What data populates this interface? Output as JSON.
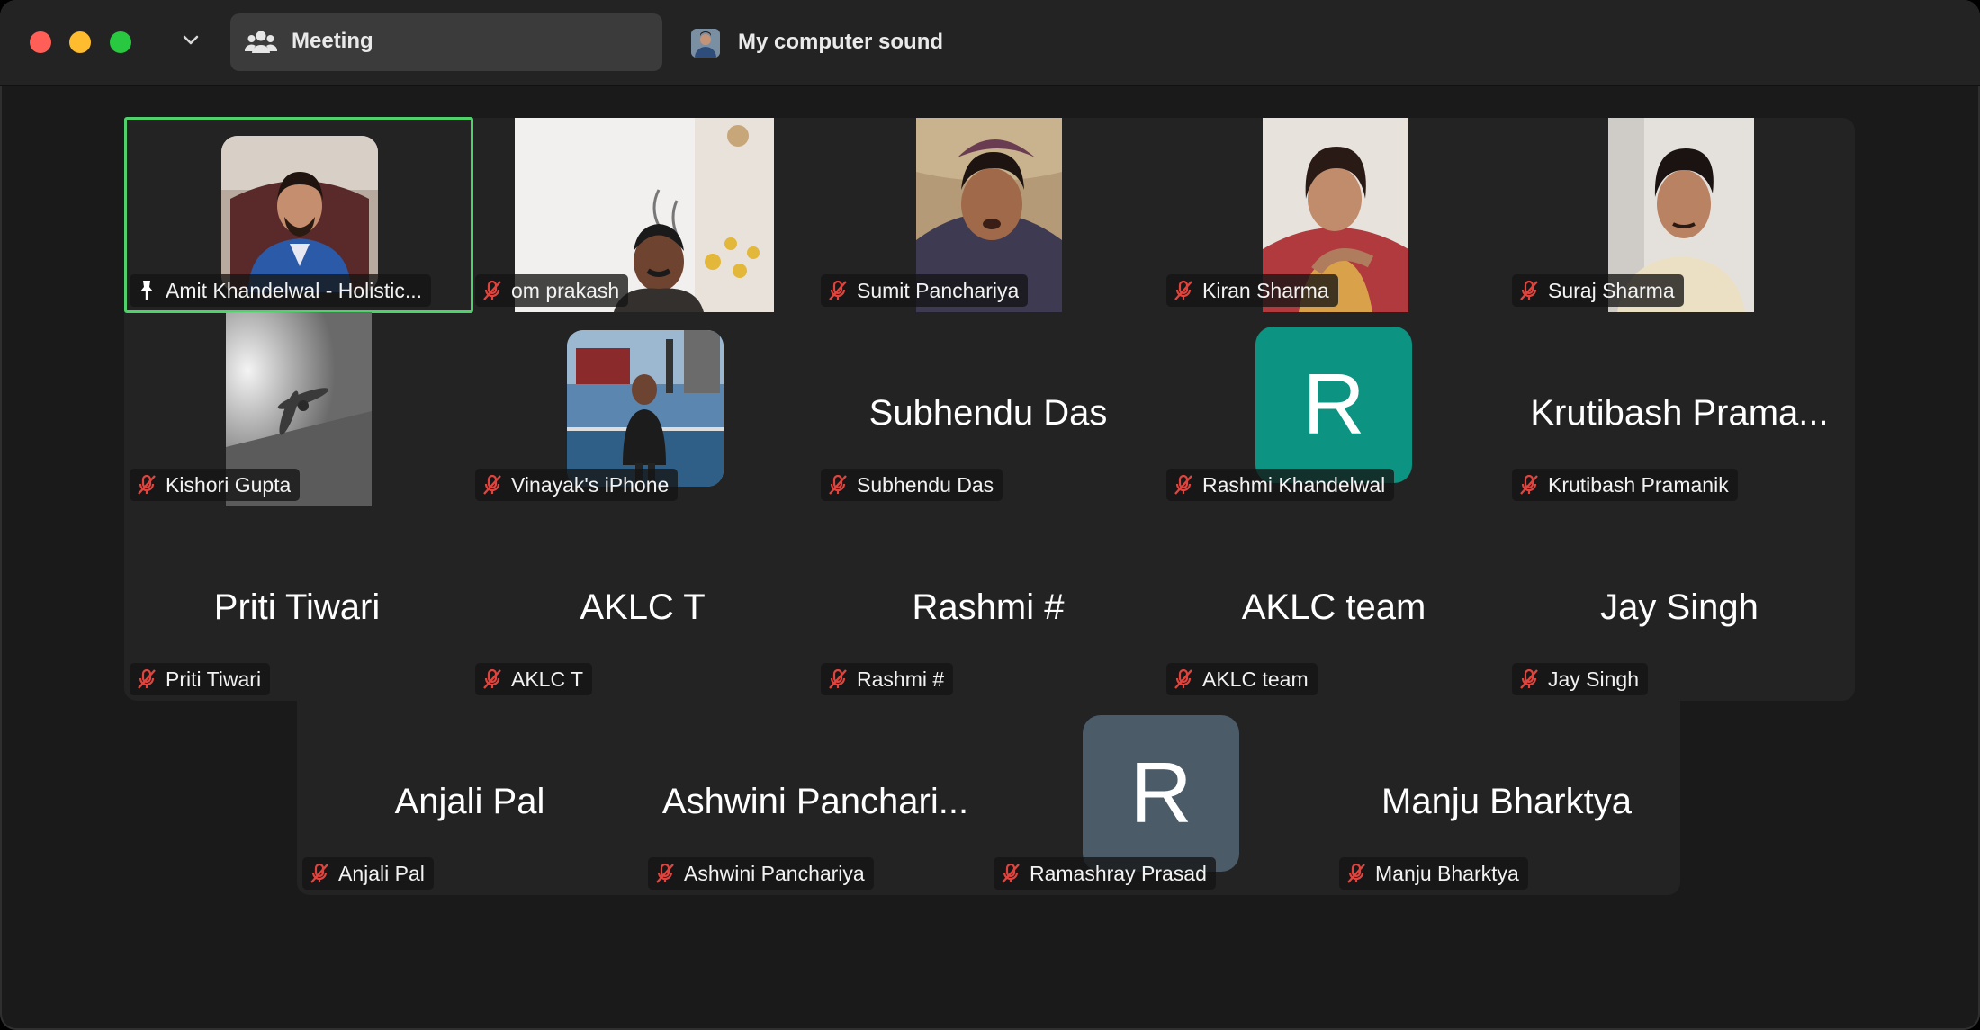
{
  "titlebar": {
    "meeting_tab_label": "Meeting",
    "sound_tab_label": "My computer sound",
    "traffic_lights": {
      "close": "#ff5f57",
      "minimize": "#febc2e",
      "zoom": "#28c840"
    }
  },
  "colors": {
    "window_bg": "#1a1a1a",
    "grid_bg": "#232323",
    "active_speaker_border": "#4fd26a",
    "muted_icon": "#e0443e",
    "avatar_teal": "#0c9382",
    "avatar_slate": "#4b5b68"
  },
  "participants": [
    {
      "display_name": "Amit Khandelwal - Holistic...",
      "tag_icon": "pin-icon",
      "video": true,
      "active_speaker": true
    },
    {
      "display_name": "om prakash",
      "tag_icon": "mic-muted-icon",
      "video": true
    },
    {
      "display_name": "Sumit Panchariya",
      "tag_icon": "mic-muted-icon",
      "video": true
    },
    {
      "display_name": "Kiran Sharma",
      "tag_icon": "mic-muted-icon",
      "video": true
    },
    {
      "display_name": "Suraj Sharma",
      "tag_icon": "mic-muted-icon",
      "video": true
    },
    {
      "display_name": "Kishori Gupta",
      "tag_icon": "mic-muted-icon",
      "video": true
    },
    {
      "display_name": "Vinayak's iPhone",
      "tag_icon": "mic-muted-icon",
      "video": true
    },
    {
      "display_name": "Subhendu Das",
      "big_name": "Subhendu Das",
      "tag_icon": "mic-muted-icon",
      "video": false
    },
    {
      "display_name": "Rashmi Khandelwal",
      "avatar_letter": "R",
      "tag_icon": "mic-muted-icon",
      "video": false
    },
    {
      "display_name": "Krutibash Pramanik",
      "big_name": "Krutibash Prama...",
      "tag_icon": "mic-muted-icon",
      "video": false
    },
    {
      "display_name": "Priti Tiwari",
      "big_name": "Priti Tiwari",
      "tag_icon": "mic-muted-icon",
      "video": false
    },
    {
      "display_name": "AKLC T",
      "big_name": "AKLC T",
      "tag_icon": "mic-muted-icon",
      "video": false
    },
    {
      "display_name": "Rashmi #",
      "big_name": "Rashmi #",
      "tag_icon": "mic-muted-icon",
      "video": false
    },
    {
      "display_name": "AKLC team",
      "big_name": "AKLC team",
      "tag_icon": "mic-muted-icon",
      "video": false
    },
    {
      "display_name": "Jay Singh",
      "big_name": "Jay Singh",
      "tag_icon": "mic-muted-icon",
      "video": false
    },
    {
      "display_name": "Anjali Pal",
      "big_name": "Anjali Pal",
      "tag_icon": "mic-muted-icon",
      "video": false
    },
    {
      "display_name": "Ashwini Panchariya",
      "big_name": "Ashwini Panchari...",
      "tag_icon": "mic-muted-icon",
      "video": false
    },
    {
      "display_name": "Ramashray Prasad",
      "avatar_letter": "R",
      "tag_icon": "mic-muted-icon",
      "video": false
    },
    {
      "display_name": "Manju Bharktya",
      "big_name": "Manju Bharktya",
      "tag_icon": "mic-muted-icon",
      "video": false
    }
  ]
}
